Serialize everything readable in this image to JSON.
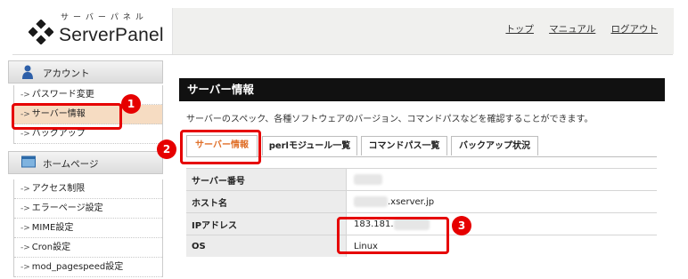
{
  "header": {
    "logo_kana": "サーバーパネル",
    "logo_name": "ServerPanel",
    "links": [
      "トップ",
      "マニュアル",
      "ログアウト"
    ]
  },
  "sidebar": {
    "account": {
      "title": "アカウント",
      "items": [
        "パスワード変更",
        "サーバー情報",
        "バックアップ"
      ]
    },
    "homepage": {
      "title": "ホームページ",
      "items": [
        "アクセス制限",
        "エラーページ設定",
        "MIME設定",
        "Cron設定",
        "mod_pagespeed設定"
      ]
    }
  },
  "main": {
    "title": "サーバー情報",
    "description": "サーバーのスペック、各種ソフトウェアのバージョン、コマンドパスなどを確認することができます。",
    "tabs": [
      "サーバー情報",
      "perlモジュール一覧",
      "コマンドパス一覧",
      "バックアップ状況"
    ],
    "rows": [
      {
        "key": "サーバー番号",
        "value": ""
      },
      {
        "key": "ホスト名",
        "value": ".xserver.jp"
      },
      {
        "key": "IPアドレス",
        "value": "183.181."
      },
      {
        "key": "OS",
        "value": "Linux"
      }
    ]
  },
  "callouts": [
    "1",
    "2",
    "3"
  ],
  "colors": {
    "highlight": "#e60000",
    "active_tab_text": "#e0702a",
    "active_sidebar_bg": "#f6dcc2",
    "title_bar": "#111111"
  }
}
